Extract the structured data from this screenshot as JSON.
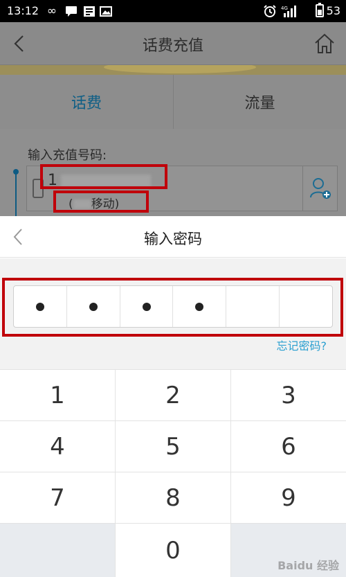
{
  "status_bar": {
    "time": "13:12",
    "battery_level": "53",
    "icons": [
      "infinity-icon",
      "message-icon",
      "news-icon",
      "image-icon",
      "alarm-icon",
      "signal-icon",
      "battery-icon"
    ]
  },
  "header": {
    "title": "话费充值",
    "back_icon": "back-chevron-icon",
    "home_icon": "home-icon"
  },
  "tabs": [
    {
      "label": "话费",
      "active": true
    },
    {
      "label": "流量",
      "active": false
    }
  ],
  "recharge_form": {
    "label": "输入充值号码:",
    "phone_value": "1",
    "carrier_prefix": "(",
    "carrier_suffix": "移动)",
    "contact_icon": "add-contact-icon"
  },
  "password_sheet": {
    "title": "输入密码",
    "back_icon": "back-chevron-icon",
    "digits_total": 6,
    "digits_entered": 4,
    "forgot_link": "忘记密码?"
  },
  "keypad": {
    "keys": [
      "1",
      "2",
      "3",
      "4",
      "5",
      "6",
      "7",
      "8",
      "9",
      "",
      "0",
      ""
    ]
  },
  "watermark": "Baidu 经验",
  "colors": {
    "accent": "#2a9fd0",
    "highlight_box": "#c0000a",
    "tab_active": "#0f5f86"
  }
}
